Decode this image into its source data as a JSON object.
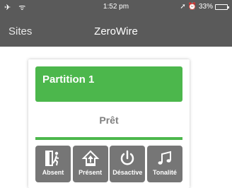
{
  "status_bar": {
    "left_icons": "✈ ᯤ",
    "time": "1:52 pm",
    "right_icons": "➚ ⏰",
    "battery_text": "33%",
    "battery_level": 0.33
  },
  "nav": {
    "back_label": "Sites",
    "title": "ZeroWire"
  },
  "partition": {
    "name": "Partition 1",
    "state": "Prêt",
    "color": "#4cb74c"
  },
  "actions": [
    {
      "label": "Absent",
      "icon": "walk-out-door-icon"
    },
    {
      "label": "Présent",
      "icon": "home-arrow-icon"
    },
    {
      "label": "Désactive",
      "icon": "power-icon"
    },
    {
      "label": "Tonalité",
      "icon": "music-notes-icon"
    }
  ]
}
